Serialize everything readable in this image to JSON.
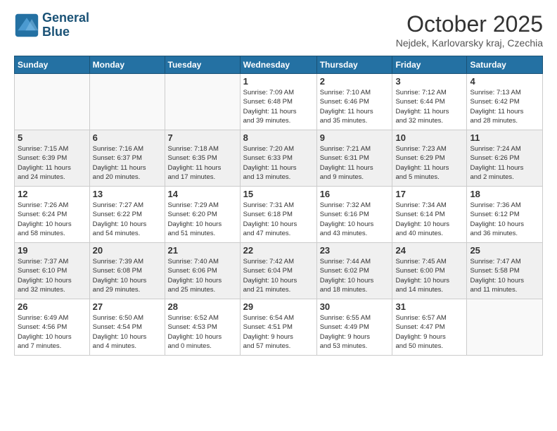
{
  "logo": {
    "line1": "General",
    "line2": "Blue"
  },
  "title": "October 2025",
  "location": "Nejdek, Karlovarsky kraj, Czechia",
  "headers": [
    "Sunday",
    "Monday",
    "Tuesday",
    "Wednesday",
    "Thursday",
    "Friday",
    "Saturday"
  ],
  "weeks": [
    [
      {
        "day": "",
        "info": ""
      },
      {
        "day": "",
        "info": ""
      },
      {
        "day": "",
        "info": ""
      },
      {
        "day": "1",
        "info": "Sunrise: 7:09 AM\nSunset: 6:48 PM\nDaylight: 11 hours\nand 39 minutes."
      },
      {
        "day": "2",
        "info": "Sunrise: 7:10 AM\nSunset: 6:46 PM\nDaylight: 11 hours\nand 35 minutes."
      },
      {
        "day": "3",
        "info": "Sunrise: 7:12 AM\nSunset: 6:44 PM\nDaylight: 11 hours\nand 32 minutes."
      },
      {
        "day": "4",
        "info": "Sunrise: 7:13 AM\nSunset: 6:42 PM\nDaylight: 11 hours\nand 28 minutes."
      }
    ],
    [
      {
        "day": "5",
        "info": "Sunrise: 7:15 AM\nSunset: 6:39 PM\nDaylight: 11 hours\nand 24 minutes."
      },
      {
        "day": "6",
        "info": "Sunrise: 7:16 AM\nSunset: 6:37 PM\nDaylight: 11 hours\nand 20 minutes."
      },
      {
        "day": "7",
        "info": "Sunrise: 7:18 AM\nSunset: 6:35 PM\nDaylight: 11 hours\nand 17 minutes."
      },
      {
        "day": "8",
        "info": "Sunrise: 7:20 AM\nSunset: 6:33 PM\nDaylight: 11 hours\nand 13 minutes."
      },
      {
        "day": "9",
        "info": "Sunrise: 7:21 AM\nSunset: 6:31 PM\nDaylight: 11 hours\nand 9 minutes."
      },
      {
        "day": "10",
        "info": "Sunrise: 7:23 AM\nSunset: 6:29 PM\nDaylight: 11 hours\nand 5 minutes."
      },
      {
        "day": "11",
        "info": "Sunrise: 7:24 AM\nSunset: 6:26 PM\nDaylight: 11 hours\nand 2 minutes."
      }
    ],
    [
      {
        "day": "12",
        "info": "Sunrise: 7:26 AM\nSunset: 6:24 PM\nDaylight: 10 hours\nand 58 minutes."
      },
      {
        "day": "13",
        "info": "Sunrise: 7:27 AM\nSunset: 6:22 PM\nDaylight: 10 hours\nand 54 minutes."
      },
      {
        "day": "14",
        "info": "Sunrise: 7:29 AM\nSunset: 6:20 PM\nDaylight: 10 hours\nand 51 minutes."
      },
      {
        "day": "15",
        "info": "Sunrise: 7:31 AM\nSunset: 6:18 PM\nDaylight: 10 hours\nand 47 minutes."
      },
      {
        "day": "16",
        "info": "Sunrise: 7:32 AM\nSunset: 6:16 PM\nDaylight: 10 hours\nand 43 minutes."
      },
      {
        "day": "17",
        "info": "Sunrise: 7:34 AM\nSunset: 6:14 PM\nDaylight: 10 hours\nand 40 minutes."
      },
      {
        "day": "18",
        "info": "Sunrise: 7:36 AM\nSunset: 6:12 PM\nDaylight: 10 hours\nand 36 minutes."
      }
    ],
    [
      {
        "day": "19",
        "info": "Sunrise: 7:37 AM\nSunset: 6:10 PM\nDaylight: 10 hours\nand 32 minutes."
      },
      {
        "day": "20",
        "info": "Sunrise: 7:39 AM\nSunset: 6:08 PM\nDaylight: 10 hours\nand 29 minutes."
      },
      {
        "day": "21",
        "info": "Sunrise: 7:40 AM\nSunset: 6:06 PM\nDaylight: 10 hours\nand 25 minutes."
      },
      {
        "day": "22",
        "info": "Sunrise: 7:42 AM\nSunset: 6:04 PM\nDaylight: 10 hours\nand 21 minutes."
      },
      {
        "day": "23",
        "info": "Sunrise: 7:44 AM\nSunset: 6:02 PM\nDaylight: 10 hours\nand 18 minutes."
      },
      {
        "day": "24",
        "info": "Sunrise: 7:45 AM\nSunset: 6:00 PM\nDaylight: 10 hours\nand 14 minutes."
      },
      {
        "day": "25",
        "info": "Sunrise: 7:47 AM\nSunset: 5:58 PM\nDaylight: 10 hours\nand 11 minutes."
      }
    ],
    [
      {
        "day": "26",
        "info": "Sunrise: 6:49 AM\nSunset: 4:56 PM\nDaylight: 10 hours\nand 7 minutes."
      },
      {
        "day": "27",
        "info": "Sunrise: 6:50 AM\nSunset: 4:54 PM\nDaylight: 10 hours\nand 4 minutes."
      },
      {
        "day": "28",
        "info": "Sunrise: 6:52 AM\nSunset: 4:53 PM\nDaylight: 10 hours\nand 0 minutes."
      },
      {
        "day": "29",
        "info": "Sunrise: 6:54 AM\nSunset: 4:51 PM\nDaylight: 9 hours\nand 57 minutes."
      },
      {
        "day": "30",
        "info": "Sunrise: 6:55 AM\nSunset: 4:49 PM\nDaylight: 9 hours\nand 53 minutes."
      },
      {
        "day": "31",
        "info": "Sunrise: 6:57 AM\nSunset: 4:47 PM\nDaylight: 9 hours\nand 50 minutes."
      },
      {
        "day": "",
        "info": ""
      }
    ]
  ]
}
